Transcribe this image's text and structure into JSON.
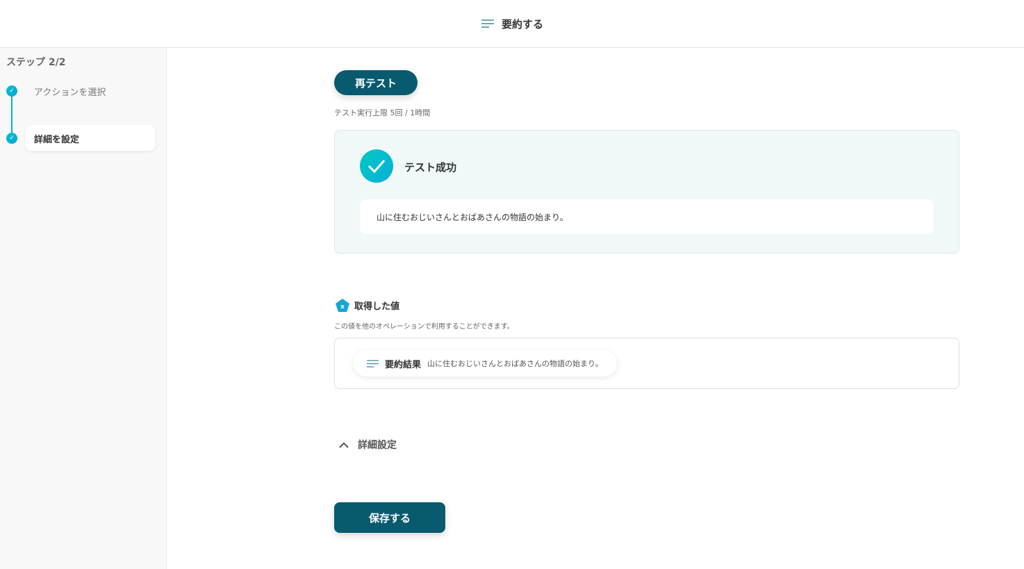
{
  "header": {
    "title": "要約する",
    "icon": "lines-icon"
  },
  "sidebar": {
    "step_label": "ステップ 2/2",
    "steps": [
      {
        "label": "アクションを選択"
      },
      {
        "label": "詳細を設定"
      }
    ]
  },
  "main": {
    "retest_label": "再テスト",
    "limit_text": "テスト実行上限 5回 / 1時間",
    "success_title": "テスト成功",
    "success_result": "山に住むおじいさんとおばあさんの物語の始まり。",
    "got_title": "取得した値",
    "got_desc": "この値を他のオペレーションで利用することができます。",
    "value_key": "要約結果",
    "value_val": "山に住むおじいさんとおばあさんの物語の始まり。",
    "advanced_label": "詳細設定",
    "save_label": "保存する"
  },
  "colors": {
    "primary": "#085a6f",
    "accent": "#00b4c8"
  }
}
